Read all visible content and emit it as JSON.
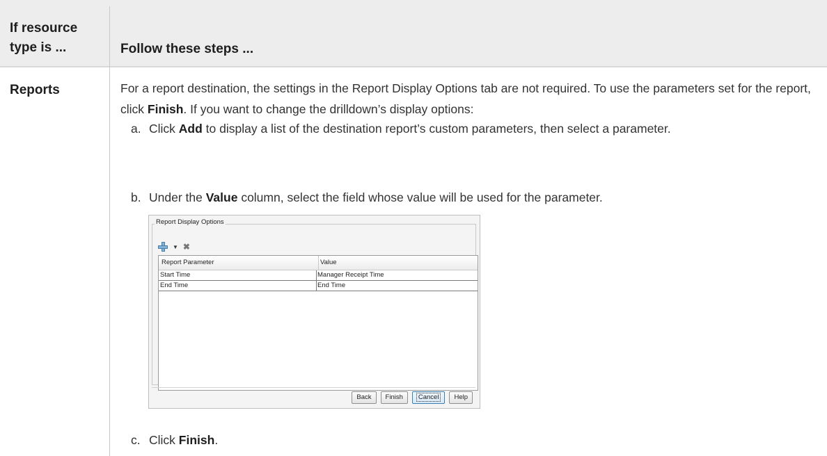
{
  "header": {
    "col1": "If resource type is ...",
    "col2": "Follow these steps ..."
  },
  "row": {
    "label": "Reports",
    "intro_part1": "For a report destination, the settings in the Report Display Options tab are not required. To use the parameters set for the report, click ",
    "intro_bold": "Finish",
    "intro_part2": ". If you want to change the drilldown’s display options:",
    "steps": [
      {
        "marker": "a.",
        "pre": "Click ",
        "bold": "Add",
        "post": " to display a list of the destination report’s custom parameters, then select a parameter."
      },
      {
        "marker": "b.",
        "pre": "Under the ",
        "bold": "Value",
        "post": " column, select the field whose value will be used for the parameter."
      },
      {
        "marker": "c.",
        "pre": "Click ",
        "bold": "Finish",
        "post": "."
      }
    ]
  },
  "dialog": {
    "group_title": "Report Display Options",
    "toolbar": {
      "add_icon": "plus-icon",
      "dropdown_icon": "triangle-down-icon",
      "delete_icon": "x-icon"
    },
    "columns": [
      "Report Parameter",
      "Value"
    ],
    "rows": [
      {
        "parameter": "Start Time",
        "value": "Manager Receipt Time"
      },
      {
        "parameter": "End Time",
        "value": "End Time"
      }
    ],
    "buttons": {
      "back": "Back",
      "finish": "Finish",
      "cancel": "Cancel",
      "help": "Help"
    }
  }
}
